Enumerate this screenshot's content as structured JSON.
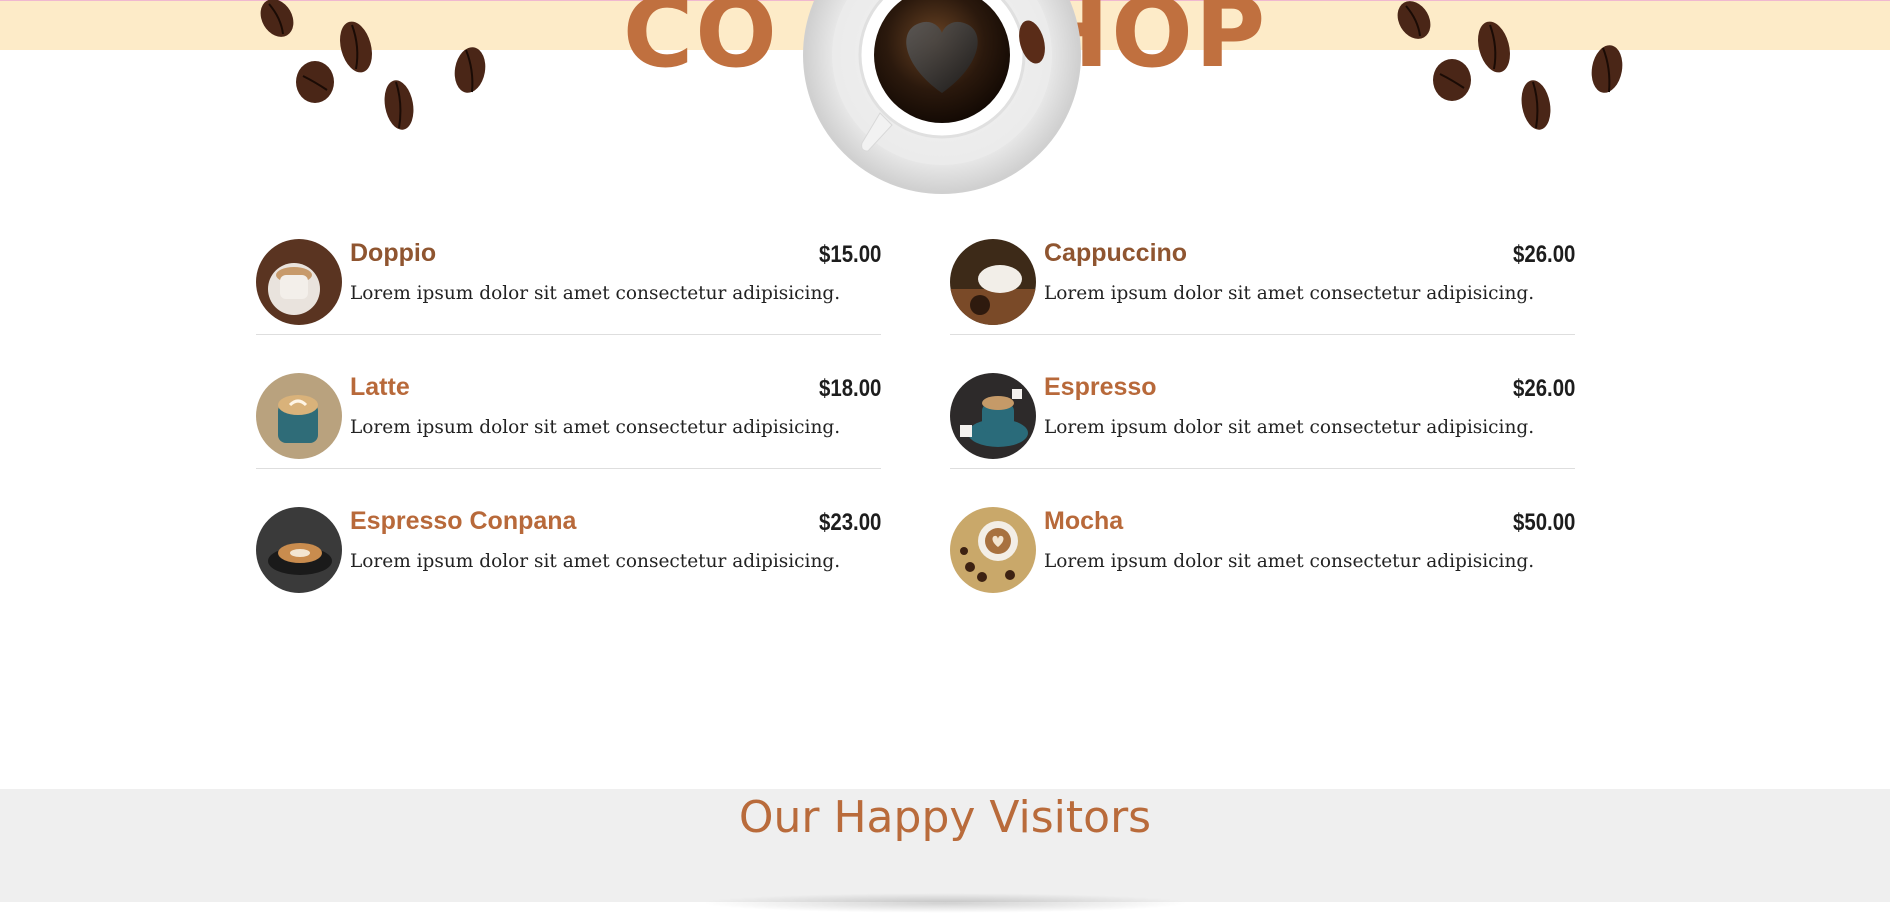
{
  "hero": {
    "title_visible": "CO  HOP",
    "title_left": "CO",
    "title_right": "HOP"
  },
  "menu": {
    "items": [
      {
        "name": "Doppio",
        "price": "$15.00",
        "description": "Lorem ipsum dolor sit amet consectetur adipisicing."
      },
      {
        "name": "Cappuccino",
        "price": "$26.00",
        "description": "Lorem ipsum dolor sit amet consectetur adipisicing."
      },
      {
        "name": "Latte",
        "price": "$18.00",
        "description": "Lorem ipsum dolor sit amet consectetur adipisicing."
      },
      {
        "name": "Espresso",
        "price": "$26.00",
        "description": "Lorem ipsum dolor sit amet consectetur adipisicing."
      },
      {
        "name": "Espresso Conpana",
        "price": "$23.00",
        "description": "Lorem ipsum dolor sit amet consectetur adipisicing."
      },
      {
        "name": "Mocha",
        "price": "$50.00",
        "description": "Lorem ipsum dolor sit amet consectetur adipisicing."
      }
    ]
  },
  "visitors": {
    "title": "Our Happy Visitors"
  },
  "colors": {
    "accent": "#c0703f",
    "band": "#fdebc8",
    "footer_bg": "#efefef"
  },
  "icons": {
    "bean": "coffee-bean-icon",
    "cup": "coffee-cup-icon"
  }
}
